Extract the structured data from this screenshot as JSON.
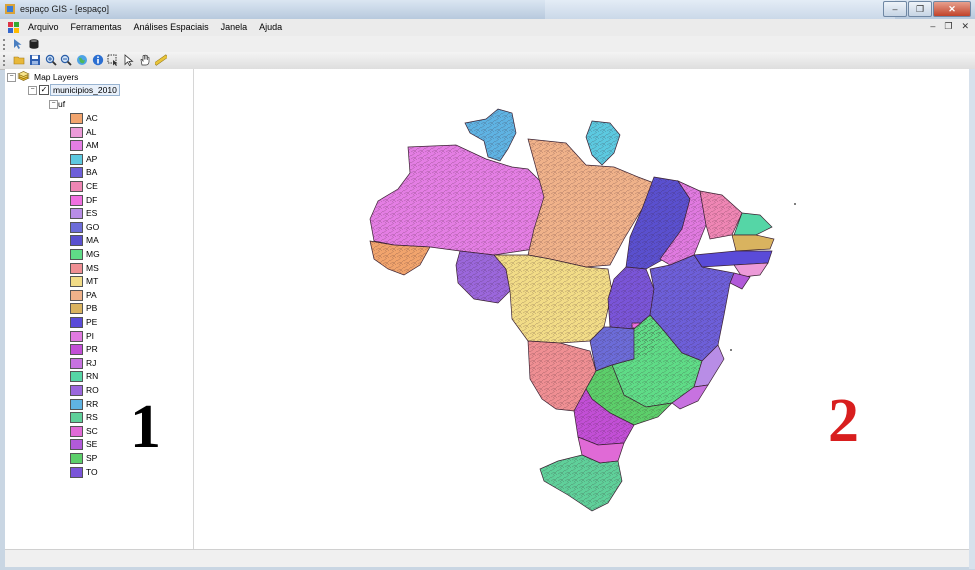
{
  "window": {
    "title": "espaço GIS - [espaço]"
  },
  "menu": {
    "items": [
      "Arquivo",
      "Ferramentas",
      "Análises Espaciais",
      "Janela",
      "Ajuda"
    ]
  },
  "tree": {
    "root": "Map Layers",
    "layer": "municipios_2010",
    "field": "uf"
  },
  "legend": [
    {
      "uf": "AC",
      "color": "#f1a46d"
    },
    {
      "uf": "AL",
      "color": "#ec9bd8"
    },
    {
      "uf": "AM",
      "color": "#e47ee4"
    },
    {
      "uf": "AP",
      "color": "#5cc9e0"
    },
    {
      "uf": "BA",
      "color": "#6d5fd9"
    },
    {
      "uf": "CE",
      "color": "#ef86b4"
    },
    {
      "uf": "DF",
      "color": "#ef6fe0"
    },
    {
      "uf": "ES",
      "color": "#b88de6"
    },
    {
      "uf": "GO",
      "color": "#6c6cd8"
    },
    {
      "uf": "MA",
      "color": "#5a50cf"
    },
    {
      "uf": "MG",
      "color": "#5fdc87"
    },
    {
      "uf": "MS",
      "color": "#ef8f93"
    },
    {
      "uf": "MT",
      "color": "#f2dc87"
    },
    {
      "uf": "PA",
      "color": "#f0b28a"
    },
    {
      "uf": "PB",
      "color": "#d9b35f"
    },
    {
      "uf": "PE",
      "color": "#5a4bd8"
    },
    {
      "uf": "PI",
      "color": "#e07ae0"
    },
    {
      "uf": "PR",
      "color": "#c24fd6"
    },
    {
      "uf": "RJ",
      "color": "#c772e0"
    },
    {
      "uf": "RN",
      "color": "#55d6a6"
    },
    {
      "uf": "RO",
      "color": "#9b67dc"
    },
    {
      "uf": "RR",
      "color": "#5fb3e3"
    },
    {
      "uf": "RS",
      "color": "#5fd09a"
    },
    {
      "uf": "SC",
      "color": "#e06ad6"
    },
    {
      "uf": "SE",
      "color": "#b15ad9"
    },
    {
      "uf": "SP",
      "color": "#5ccf6a"
    },
    {
      "uf": "TO",
      "color": "#7a55d8"
    }
  ],
  "annotations": {
    "left": "1",
    "right": "2",
    "left_color": "#000000",
    "right_color": "#d81e1e"
  },
  "icons": {
    "toolbar1": [
      "cursor-icon",
      "database-icon"
    ],
    "toolbar2": [
      "open-folder-icon",
      "save-icon",
      "zoom-in-icon",
      "zoom-out-icon",
      "full-extent-icon",
      "info-icon",
      "select-rectangle-icon",
      "select-pointer-icon",
      "pan-hand-icon",
      "measure-icon"
    ]
  }
}
